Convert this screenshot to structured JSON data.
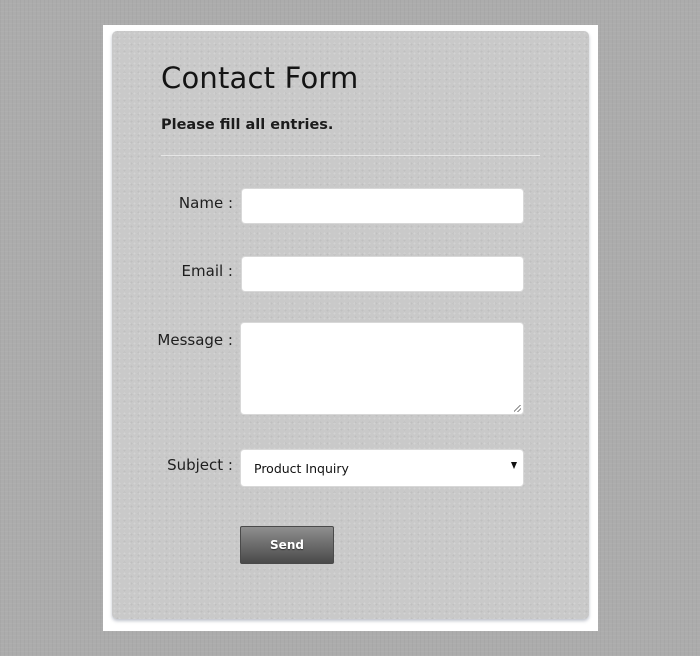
{
  "form": {
    "title": "Contact Form",
    "subtitle": "Please fill all entries.",
    "fields": {
      "name": {
        "label": "Name :",
        "value": ""
      },
      "email": {
        "label": "Email :",
        "value": ""
      },
      "message": {
        "label": "Message :",
        "value": ""
      },
      "subject": {
        "label": "Subject :",
        "selected": "Product Inquiry"
      }
    },
    "submit_label": "Send"
  },
  "colors": {
    "page_background": "#acacac",
    "panel_background": "#c9c9c9",
    "frame_background": "#ffffff",
    "button_gradient_top": "#8f8f8f",
    "button_gradient_bottom": "#4a4a4a"
  },
  "icons": {
    "select_arrow": "chevron-down-icon",
    "textarea_grip": "resize-grip-icon"
  }
}
